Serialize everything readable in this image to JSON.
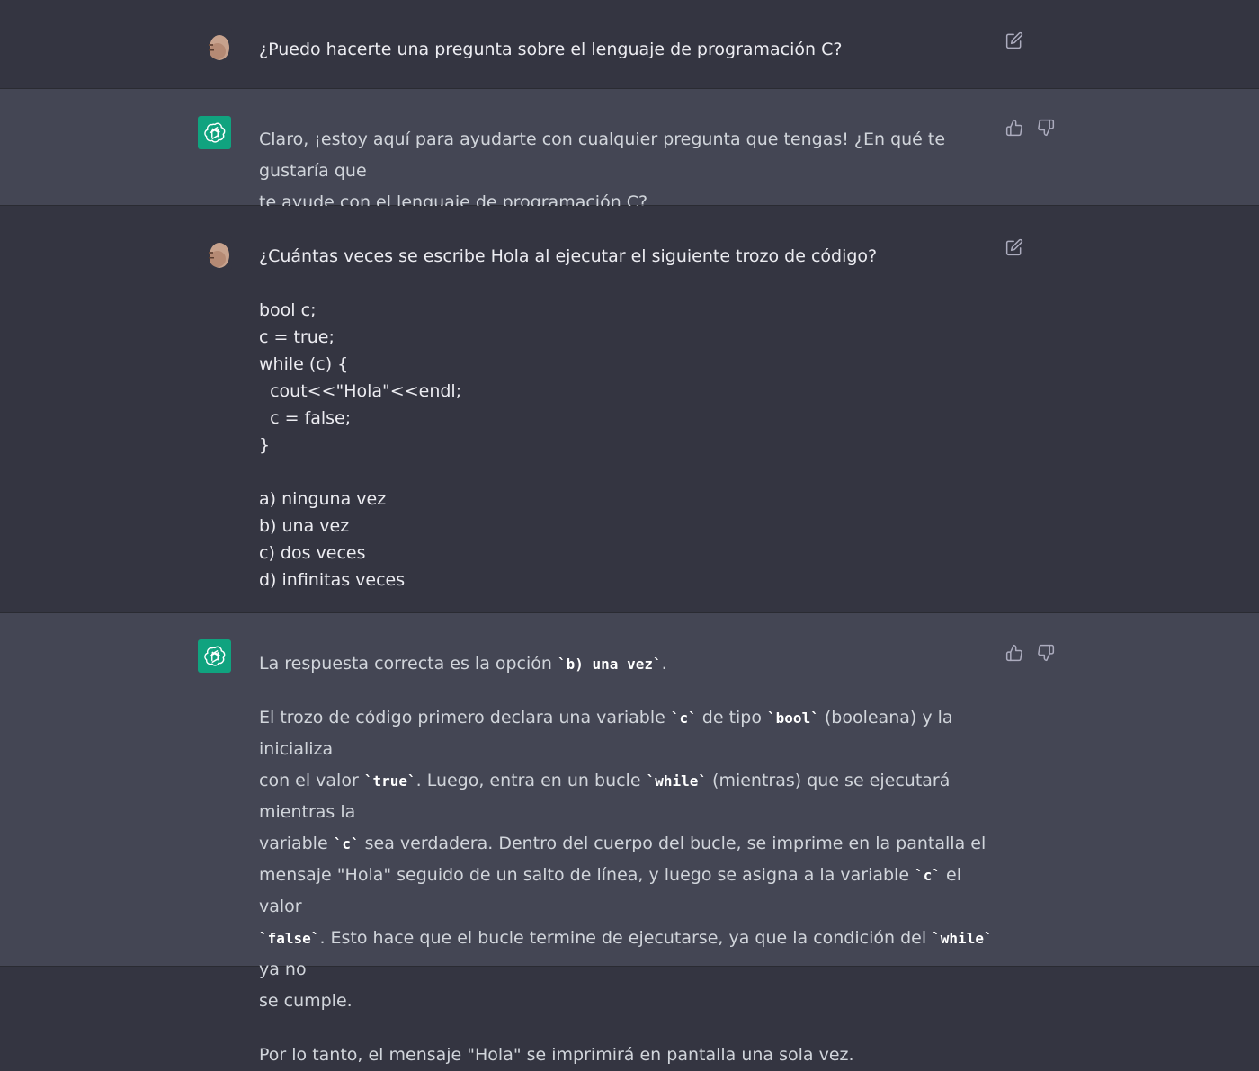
{
  "conversation": [
    {
      "role": "user",
      "lines": [
        "¿Puedo hacerte una pregunta sobre el lenguaje de programación C?"
      ]
    },
    {
      "role": "assistant",
      "lines": [
        "Claro, ¡estoy aquí para ayudarte con cualquier pregunta que tengas! ¿En qué te gustaría que",
        "te ayude con el lenguaje de programación C?"
      ]
    },
    {
      "role": "user",
      "question": "¿Cuántas veces se escribe Hola al ejecutar el siguiente trozo de código?",
      "code": [
        "bool c;",
        "c = true;",
        "while (c) {",
        "  cout<<\"Hola\"<<endl;",
        "  c = false;",
        "}"
      ],
      "options": [
        "a) ninguna vez",
        "b) una vez",
        "c) dos veces",
        "d) infinitas veces"
      ]
    },
    {
      "role": "assistant",
      "answer_prefix": "La respuesta correcta es la opción ",
      "answer_code": "`b) una vez`",
      "answer_suffix": ".",
      "explanation": {
        "l1_a": "El trozo de código primero declara una variable ",
        "l1_c1": "`c`",
        "l1_b": " de tipo ",
        "l1_c2": "`bool`",
        "l1_d": " (booleana) y la inicializa",
        "l2_a": "con el valor ",
        "l2_c1": "`true`",
        "l2_b": ". Luego, entra en un bucle ",
        "l2_c2": "`while`",
        "l2_d": " (mientras) que se ejecutará mientras la",
        "l3_a": "variable ",
        "l3_c1": "`c`",
        "l3_b": " sea verdadera. Dentro del cuerpo del bucle, se imprime en la pantalla el",
        "l4_a": "mensaje \"Hola\" seguido de un salto de línea, y luego se asigna a la variable ",
        "l4_c1": "`c`",
        "l4_b": " el valor",
        "l5_c1": "`false`",
        "l5_a": ". Esto hace que el bucle termine de ejecutarse, ya que la condición del ",
        "l5_c2": "`while`",
        "l5_b": " ya no",
        "l6_a": "se cumple."
      },
      "conclusion": "Por lo tanto, el mensaje \"Hola\" se imprimirá en pantalla una sola vez."
    }
  ],
  "icons": {
    "edit": "edit-icon",
    "thumbs_up": "thumbs-up-icon",
    "thumbs_down": "thumbs-down-icon",
    "assistant_logo": "openai-logo-icon"
  },
  "colors": {
    "user_bg": "#343541",
    "assistant_bg": "#444654",
    "brand": "#10a37f"
  }
}
